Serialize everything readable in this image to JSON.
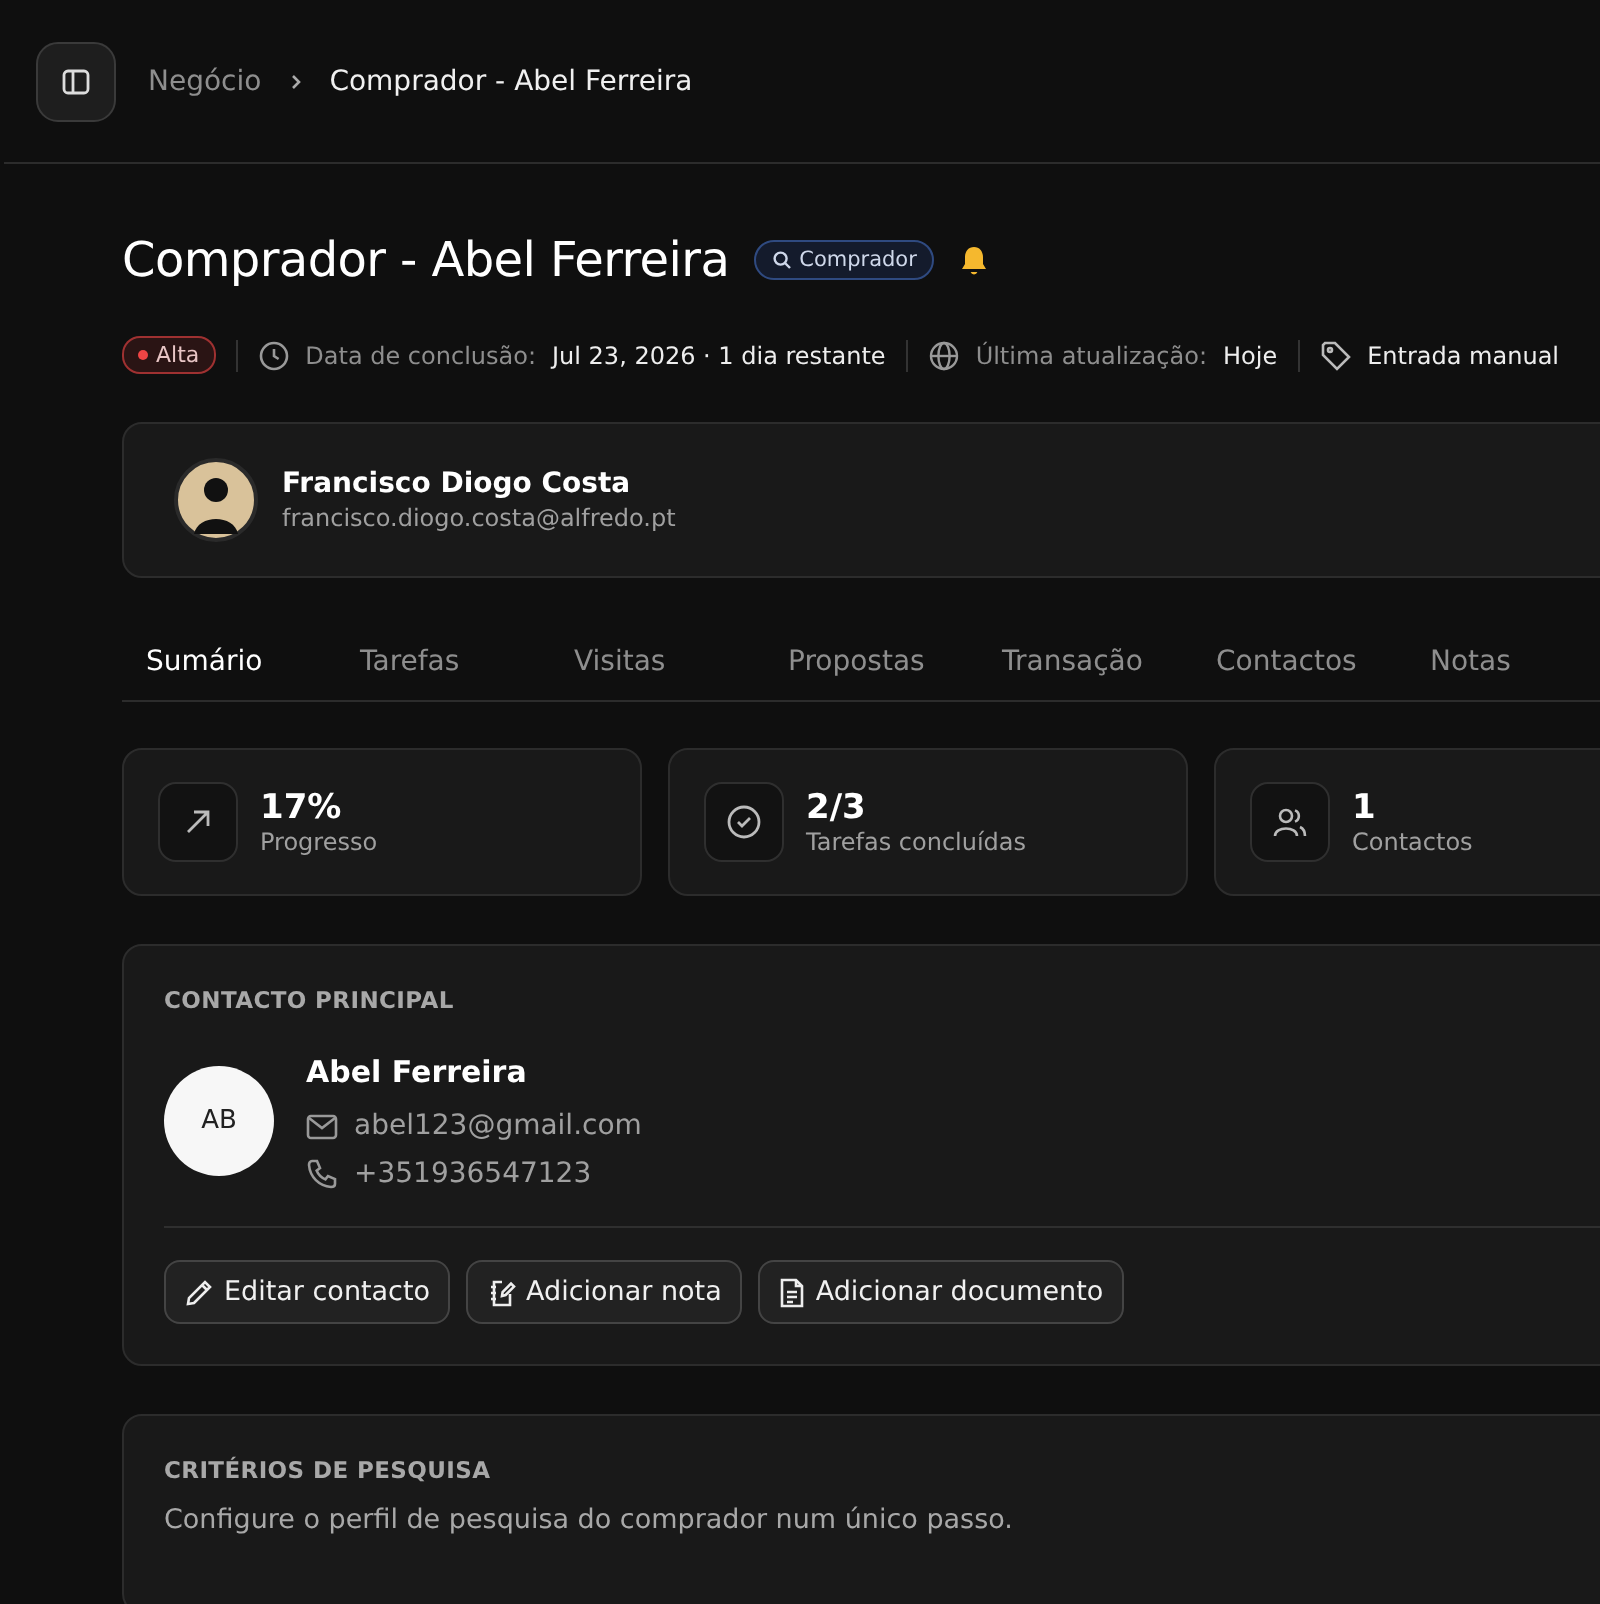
{
  "breadcrumb": [
    {
      "label": "Negócio",
      "selected": false
    },
    {
      "label": "Comprador - Abel Ferreira",
      "selected": true
    }
  ],
  "title": "Comprador - Abel Ferreira",
  "type_badge": "Comprador",
  "meta": {
    "priority": {
      "label": "Alta",
      "color": "#ef4444"
    },
    "due_label": "Data de conclusão:",
    "due_value": "Jul 23, 2026 · 1 dia restante",
    "updated_label": "Última atualização:",
    "updated_value": "Hoje",
    "source": "Entrada manual"
  },
  "agent": {
    "name": "Francisco Diogo Costa",
    "email": "francisco.diogo.costa@alfredo.pt"
  },
  "tabs": [
    {
      "label": "Sumário",
      "selected": true
    },
    {
      "label": "Tarefas",
      "selected": false
    },
    {
      "label": "Visitas",
      "selected": false
    },
    {
      "label": "Propostas",
      "selected": false
    },
    {
      "label": "Transação",
      "selected": false
    },
    {
      "label": "Contactos",
      "selected": false
    },
    {
      "label": "Notas",
      "selected": false
    }
  ],
  "stats": [
    {
      "kind": "progress",
      "value": "17%",
      "label": "Progresso"
    },
    {
      "kind": "tasks",
      "value": "2/3",
      "label": "Tarefas concluídas"
    },
    {
      "kind": "contacts",
      "value": "1",
      "label": "Contactos"
    }
  ],
  "main_contact": {
    "heading": "CONTACTO PRINCIPAL",
    "initials": "AB",
    "name": "Abel Ferreira",
    "email": "abel123@gmail.com",
    "phone": "+351936547123",
    "actions": [
      {
        "kind": "edit",
        "label": "Editar contacto"
      },
      {
        "kind": "note",
        "label": "Adicionar nota"
      },
      {
        "kind": "document",
        "label": "Adicionar documento"
      }
    ]
  },
  "search_criteria": {
    "heading": "CRITÉRIOS DE PESQUISA",
    "description": "Configure o perfil de pesquisa do comprador num único passo."
  }
}
